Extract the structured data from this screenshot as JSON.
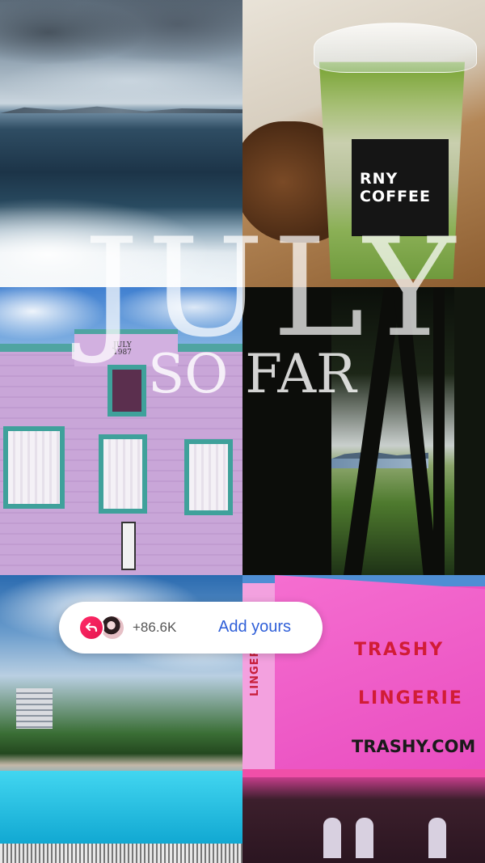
{
  "story": {
    "title_line1": "JULY",
    "title_line2": "SO FAR"
  },
  "photos": [
    {
      "label": "ocean-wake"
    },
    {
      "label": "matcha-coffee",
      "cup_text_line1": "RNY",
      "cup_text_line2": "COFFEE"
    },
    {
      "label": "pink-building",
      "sign_line1": "JULY",
      "sign_line2": "1987"
    },
    {
      "label": "forest"
    },
    {
      "label": "pool"
    },
    {
      "label": "pink-shop",
      "sign_line1": "TRASHY",
      "sign_line2": "LINGERIE",
      "url": "TRASHY.COM",
      "side_sign": "LINGERIE"
    }
  ],
  "add_yours": {
    "count": "+86.6K",
    "cta_label": "Add yours",
    "icon": "reply-arrow-icon",
    "accent_color": "#ff2a68",
    "cta_color": "#2f5fd8"
  }
}
